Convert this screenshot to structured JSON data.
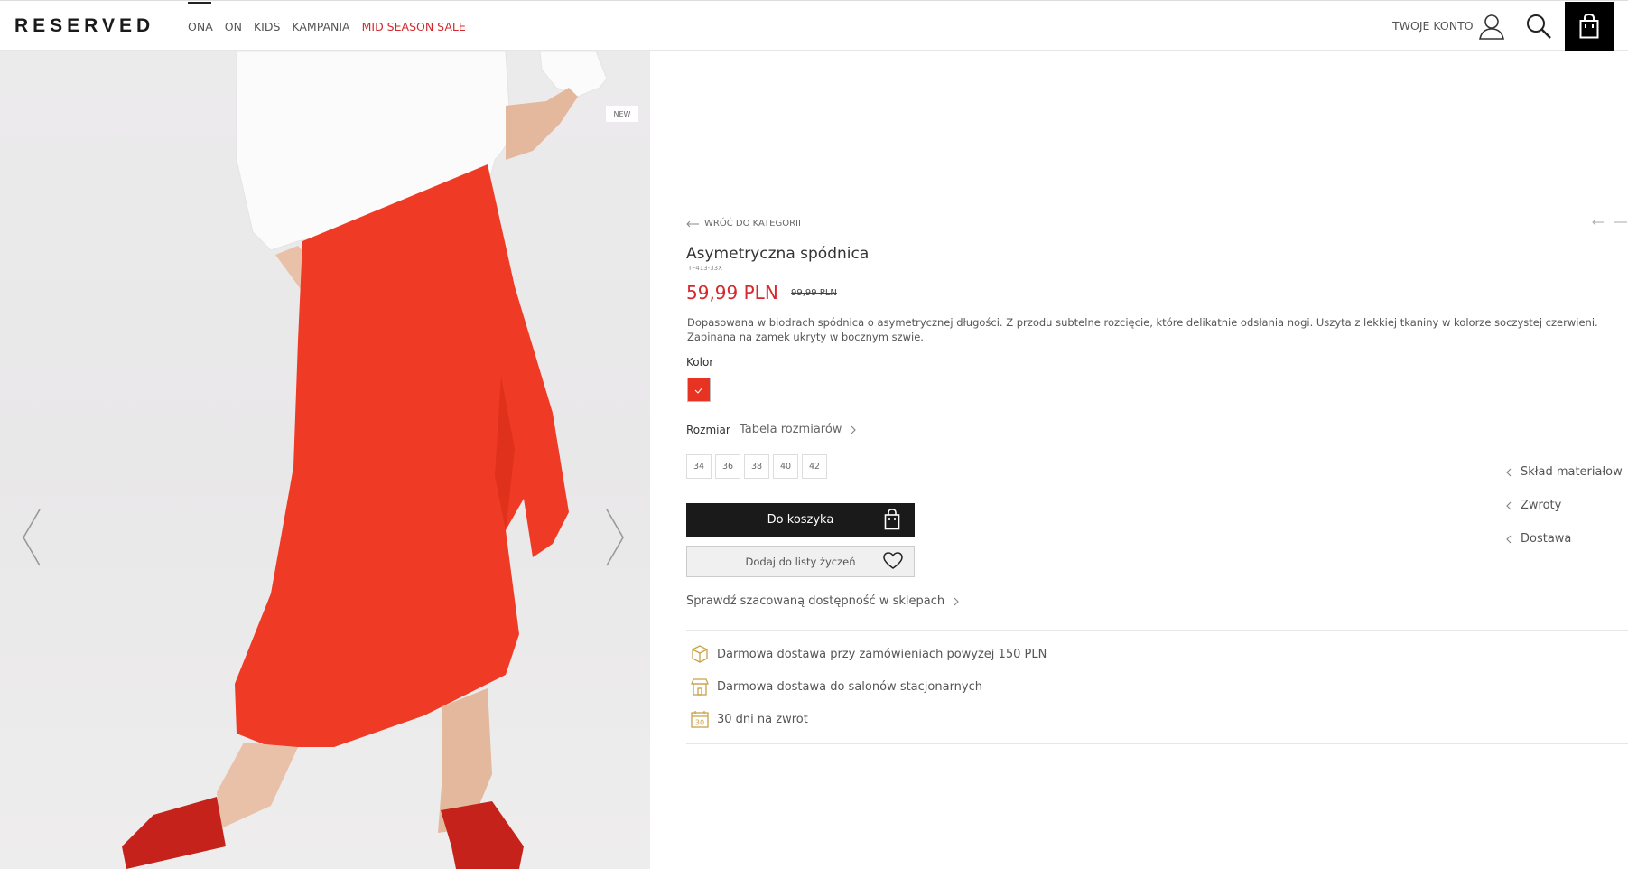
{
  "header": {
    "logo": "RESERVED",
    "nav": [
      {
        "label": "ONA"
      },
      {
        "label": "ON"
      },
      {
        "label": "KIDS"
      },
      {
        "label": "KAMPANIA"
      },
      {
        "label": "MID SEASON SALE"
      }
    ],
    "account_label": "TWOJE KONTO"
  },
  "gallery": {
    "badge": "NEW"
  },
  "product": {
    "back_label": "WRÓĆ DO KATEGORII",
    "title": "Asymetryczna spódnica",
    "sku": "TF413-33X",
    "price": "59,99 PLN",
    "old_price": "99,99 PLN",
    "description": "Dopasowana w biodrach spódnica o asymetrycznej długości. Z przodu subtelne rozcięcie, które delikatnie odsłania nogi. Uszyta z lekkiej tkaniny w kolorze soczystej czerwieni. Zapinana na zamek ukryty w bocznym szwie.",
    "color_label": "Kolor",
    "size_label": "Rozmiar",
    "size_table_label": "Tabela rozmiarów",
    "sizes": [
      "34",
      "36",
      "38",
      "40",
      "42"
    ],
    "add_to_cart_label": "Do koszyka",
    "wishlist_label": "Dodaj do listy życzeń",
    "availability_label": "Sprawdź szacowaną dostępność w sklepach"
  },
  "benefits": [
    {
      "text": "Darmowa dostawa przy zamówieniach powyżej 150 PLN",
      "icon": "box-icon"
    },
    {
      "text": "Darmowa dostawa do salonów stacjonarnych",
      "icon": "store-icon"
    },
    {
      "text": "30 dni na zwrot",
      "icon": "calendar-icon",
      "icon_text": "30"
    }
  ],
  "side_links": [
    {
      "label": "Skład materiałow"
    },
    {
      "label": "Zwroty"
    },
    {
      "label": "Dostawa"
    }
  ],
  "colors": {
    "sale": "#d4292e",
    "swatch": "#e63322",
    "skirt": "#ef3a25",
    "icon_gold": "#c9a24a"
  }
}
